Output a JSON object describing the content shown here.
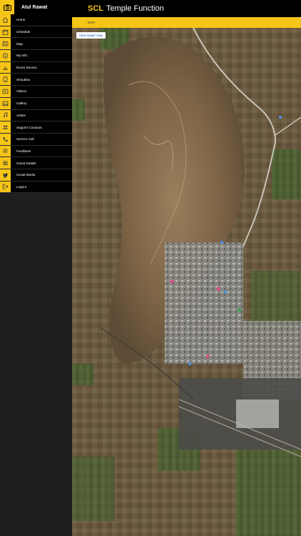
{
  "user": {
    "name": "Atul Rawat"
  },
  "header": {
    "brand": "SCL",
    "title": "Temple Function"
  },
  "subheader": {
    "crumb": "MAP"
  },
  "map": {
    "larger_link": "View larger map"
  },
  "menu": [
    {
      "label": "Home",
      "icon": "home-icon"
    },
    {
      "label": "Schedule",
      "icon": "calendar-icon"
    },
    {
      "label": "Map",
      "icon": "map-icon"
    },
    {
      "label": "My Info",
      "icon": "info-icon"
    },
    {
      "label": "Room Service",
      "icon": "bell-icon"
    },
    {
      "label": "Shoutbox",
      "icon": "shoutbox-icon"
    },
    {
      "label": "Videos",
      "icon": "video-icon"
    },
    {
      "label": "Gallery",
      "icon": "gallery-icon"
    },
    {
      "label": "Artists",
      "icon": "music-note-icon"
    },
    {
      "label": "Support Contacts",
      "icon": "contacts-icon"
    },
    {
      "label": "Service Call",
      "icon": "phone-icon"
    },
    {
      "label": "Feedback",
      "icon": "feedback-icon"
    },
    {
      "label": "Guest Details",
      "icon": "guest-list-icon"
    },
    {
      "label": "Social Media",
      "icon": "twitter-icon"
    },
    {
      "label": "Logout",
      "icon": "logout-icon"
    }
  ],
  "colors": {
    "accent": "#f5c518",
    "bar": "#000000",
    "sidebar_bg": "#1f1f1f"
  }
}
